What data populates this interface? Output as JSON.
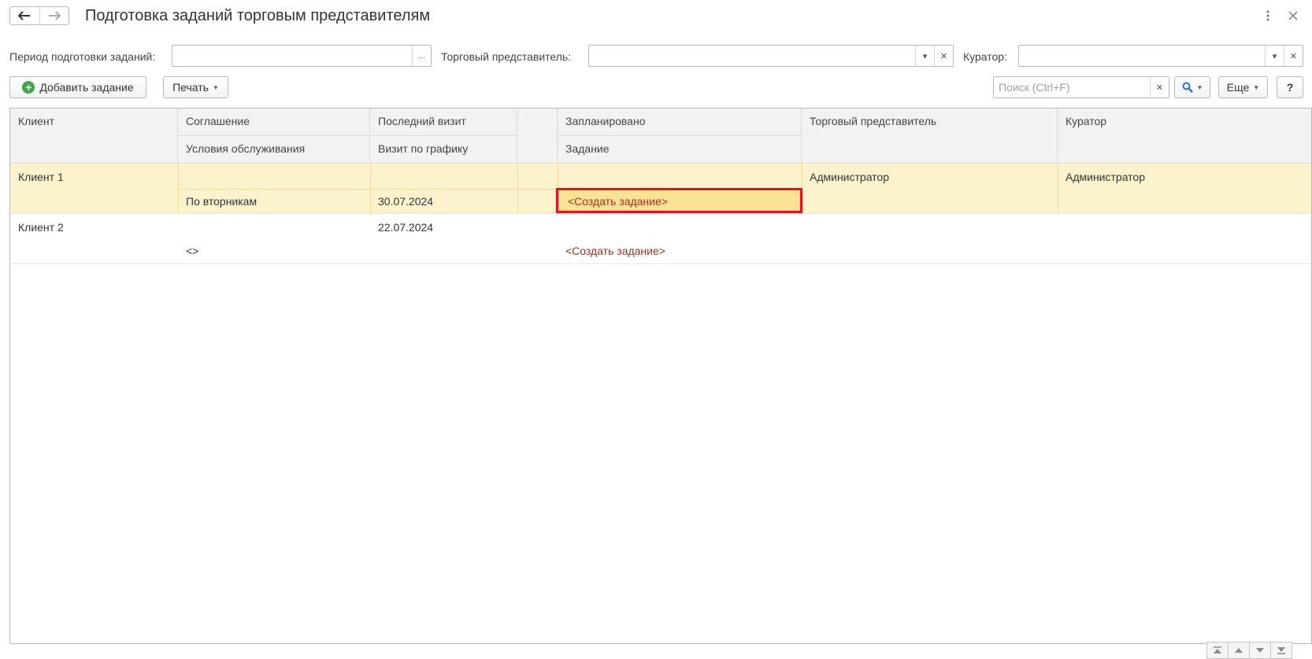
{
  "window": {
    "title": "Подготовка заданий торговым представителям"
  },
  "filters": {
    "period_label": "Период подготовки заданий:",
    "period_value": "",
    "period_button": "...",
    "rep_label": "Торговый представитель:",
    "rep_value": "",
    "curator_label": "Куратор:",
    "curator_value": ""
  },
  "toolbar": {
    "add_label": "Добавить задание",
    "print_label": "Печать",
    "search_placeholder": "Поиск (Ctrl+F)",
    "more_label": "Еще",
    "help_label": "?"
  },
  "table": {
    "headers": {
      "client": "Клиент",
      "agreement": "Соглашение",
      "service_terms": "Условия обслуживания",
      "last_visit": "Последний визит",
      "scheduled_visit": "Визит по графику",
      "planned": "Запланировано",
      "task": "Задание",
      "rep": "Торговый представитель",
      "curator": "Куратор"
    },
    "rows": [
      {
        "client": "Клиент 1",
        "agreement": "",
        "service_terms": "По вторникам",
        "last_visit": "",
        "scheduled_visit": "30.07.2024",
        "planned": "",
        "task": "<Создать задание>",
        "rep": "Администратор",
        "curator": "Администратор"
      },
      {
        "client": "Клиент 2",
        "agreement": "",
        "service_terms": "<>",
        "last_visit": "22.07.2024",
        "scheduled_visit": "",
        "planned": "",
        "task": "<Создать задание>",
        "rep": "",
        "curator": ""
      }
    ]
  },
  "colors": {
    "selected_row": "#fcf3cc",
    "active_cell": "#fce294",
    "highlight_border": "#e8101a",
    "link": "#a1321f",
    "add_icon": "#3fa549"
  }
}
